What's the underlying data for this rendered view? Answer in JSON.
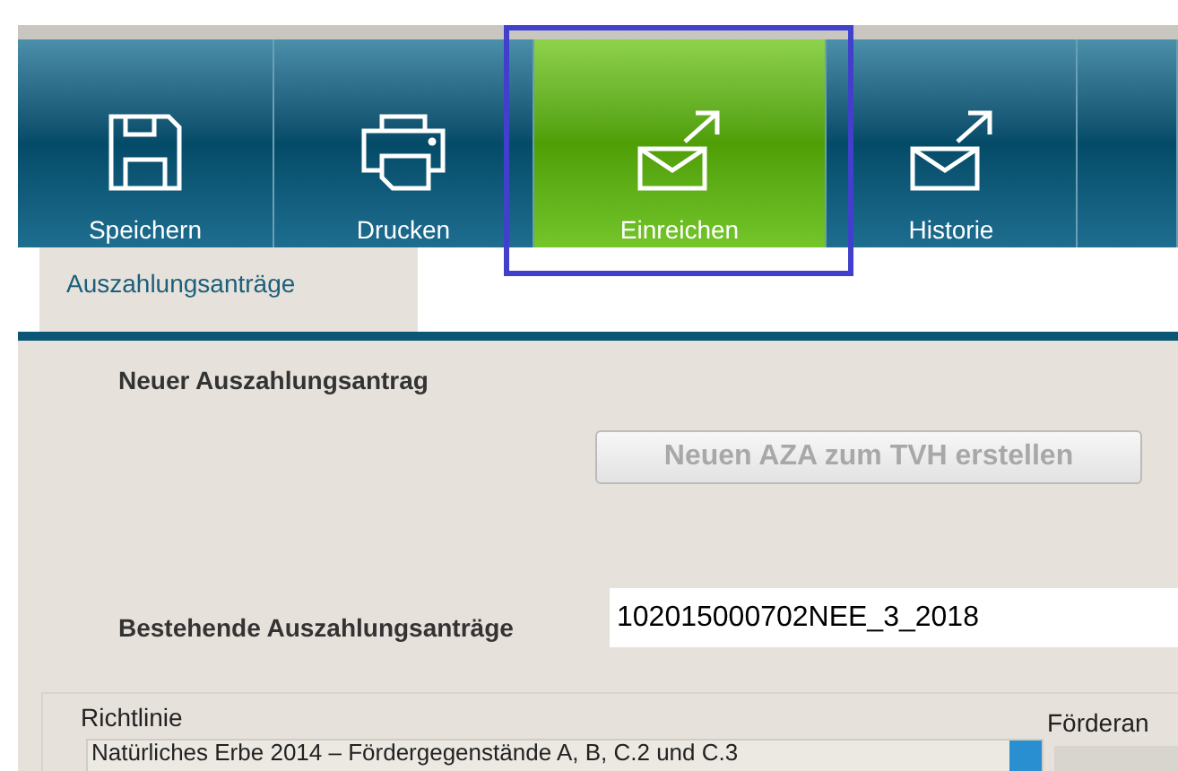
{
  "toolbar": [
    {
      "label": "Speichern",
      "kind": "save",
      "selected": false
    },
    {
      "label": "Drucken",
      "kind": "print",
      "selected": false
    },
    {
      "label": "Einreichen",
      "kind": "send",
      "selected": true
    },
    {
      "label": "Historie",
      "kind": "send",
      "selected": false
    },
    {
      "kind": "blank",
      "selected": false
    }
  ],
  "tabs": [
    {
      "label": "Auszahlungsanträge",
      "selected": true
    }
  ],
  "section_title": "Neuer Auszahlungsantrag",
  "create_button": {
    "label": "Neuen AZA zum TVH erstellen",
    "disabled": true
  },
  "existing": {
    "label": "Bestehende Auszahlungsanträge",
    "value": "102015000702NEE_3_2018"
  },
  "richtlinie": {
    "label": "Richtlinie",
    "value": "Natürliches Erbe 2014 – Fördergegenstände A, B, C.2 und C.3"
  },
  "column_2_label": "Förderan"
}
